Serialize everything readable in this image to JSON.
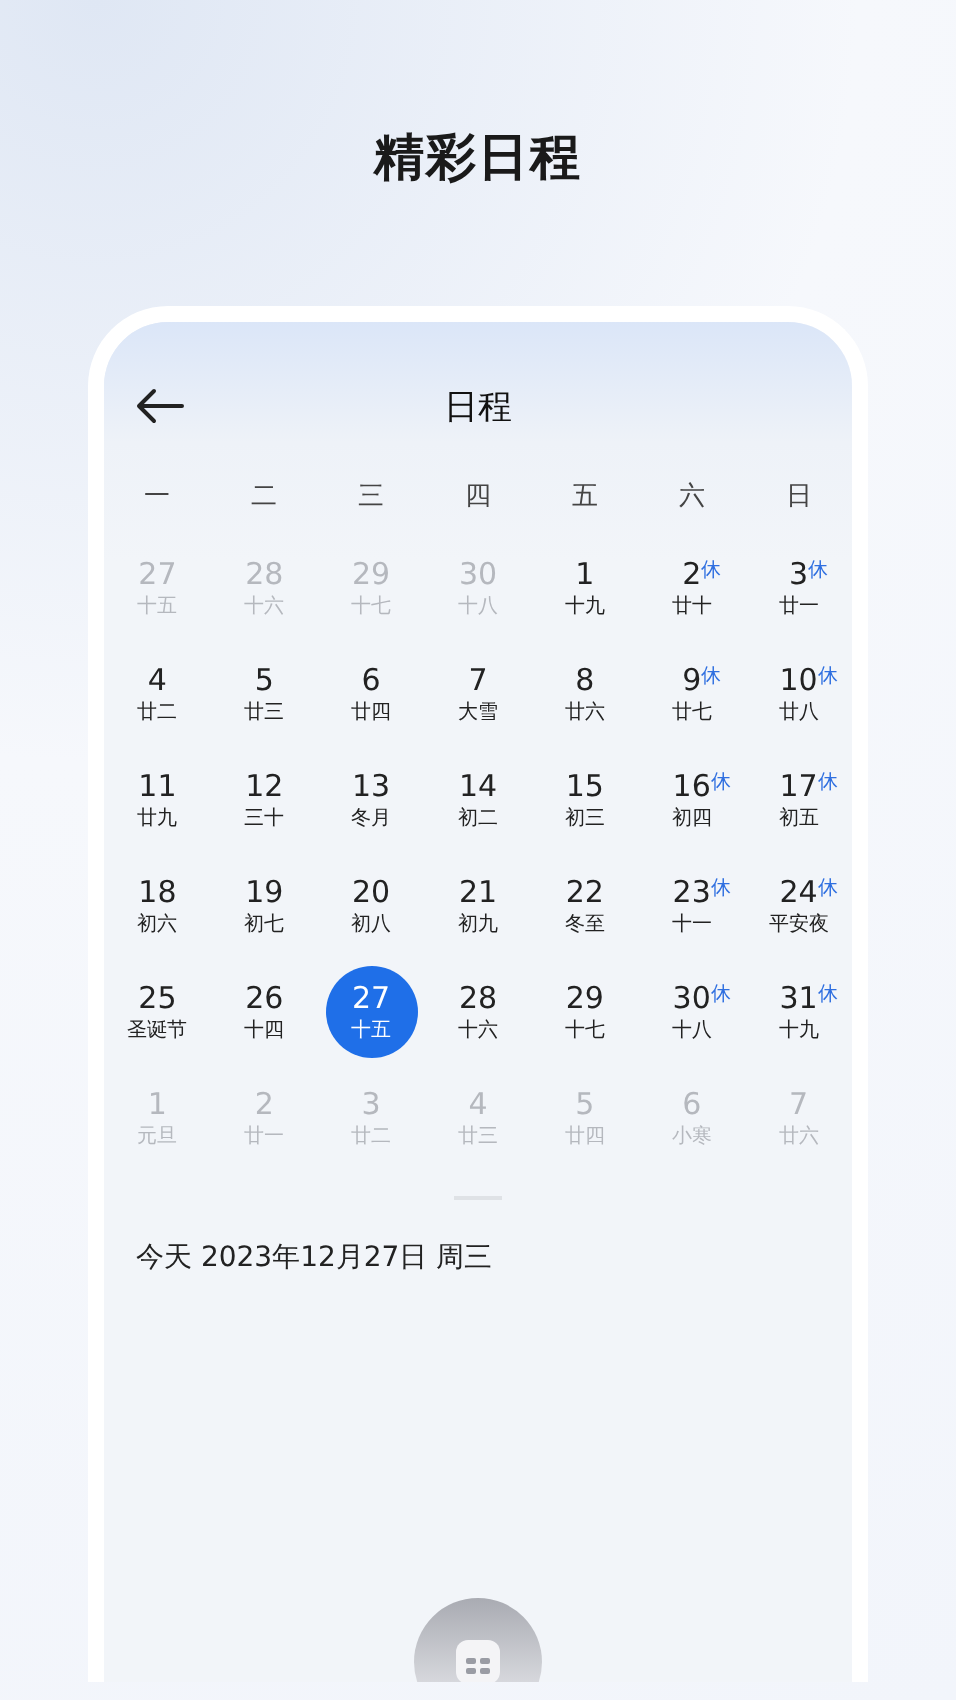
{
  "page_title": "精彩日程",
  "screen": {
    "title": "日程",
    "weekdays": [
      "一",
      "二",
      "三",
      "四",
      "五",
      "六",
      "日"
    ],
    "days": [
      {
        "day": "27",
        "lunar": "十五",
        "muted": true,
        "selected": false
      },
      {
        "day": "28",
        "lunar": "十六",
        "muted": true,
        "selected": false
      },
      {
        "day": "29",
        "lunar": "十七",
        "muted": true,
        "selected": false
      },
      {
        "day": "30",
        "lunar": "十八",
        "muted": true,
        "selected": false
      },
      {
        "day": "1",
        "lunar": "十九",
        "muted": false,
        "selected": false
      },
      {
        "day": "2",
        "lunar": "廿十",
        "badge": "休",
        "muted": false,
        "selected": false
      },
      {
        "day": "3",
        "lunar": "廿一",
        "badge": "休",
        "muted": false,
        "selected": false
      },
      {
        "day": "4",
        "lunar": "廿二",
        "muted": false,
        "selected": false
      },
      {
        "day": "5",
        "lunar": "廿三",
        "muted": false,
        "selected": false
      },
      {
        "day": "6",
        "lunar": "廿四",
        "muted": false,
        "selected": false
      },
      {
        "day": "7",
        "lunar": "大雪",
        "muted": false,
        "selected": false
      },
      {
        "day": "8",
        "lunar": "廿六",
        "muted": false,
        "selected": false
      },
      {
        "day": "9",
        "lunar": "廿七",
        "badge": "休",
        "muted": false,
        "selected": false
      },
      {
        "day": "10",
        "lunar": "廿八",
        "badge": "休",
        "muted": false,
        "selected": false
      },
      {
        "day": "11",
        "lunar": "廿九",
        "muted": false,
        "selected": false
      },
      {
        "day": "12",
        "lunar": "三十",
        "muted": false,
        "selected": false
      },
      {
        "day": "13",
        "lunar": "冬月",
        "muted": false,
        "selected": false
      },
      {
        "day": "14",
        "lunar": "初二",
        "muted": false,
        "selected": false
      },
      {
        "day": "15",
        "lunar": "初三",
        "muted": false,
        "selected": false
      },
      {
        "day": "16",
        "lunar": "初四",
        "badge": "休",
        "muted": false,
        "selected": false
      },
      {
        "day": "17",
        "lunar": "初五",
        "badge": "休",
        "muted": false,
        "selected": false
      },
      {
        "day": "18",
        "lunar": "初六",
        "muted": false,
        "selected": false
      },
      {
        "day": "19",
        "lunar": "初七",
        "muted": false,
        "selected": false
      },
      {
        "day": "20",
        "lunar": "初八",
        "muted": false,
        "selected": false
      },
      {
        "day": "21",
        "lunar": "初九",
        "muted": false,
        "selected": false
      },
      {
        "day": "22",
        "lunar": "冬至",
        "muted": false,
        "selected": false
      },
      {
        "day": "23",
        "lunar": "十一",
        "badge": "休",
        "muted": false,
        "selected": false
      },
      {
        "day": "24",
        "lunar": "平安夜",
        "badge": "休",
        "muted": false,
        "selected": false
      },
      {
        "day": "25",
        "lunar": "圣诞节",
        "muted": false,
        "selected": false
      },
      {
        "day": "26",
        "lunar": "十四",
        "muted": false,
        "selected": false
      },
      {
        "day": "27",
        "lunar": "十五",
        "muted": false,
        "selected": true
      },
      {
        "day": "28",
        "lunar": "十六",
        "muted": false,
        "selected": false
      },
      {
        "day": "29",
        "lunar": "十七",
        "muted": false,
        "selected": false
      },
      {
        "day": "30",
        "lunar": "十八",
        "badge": "休",
        "muted": false,
        "selected": false
      },
      {
        "day": "31",
        "lunar": "十九",
        "badge": "休",
        "muted": false,
        "selected": false
      },
      {
        "day": "1",
        "lunar": "元旦",
        "muted": true,
        "selected": false
      },
      {
        "day": "2",
        "lunar": "廿一",
        "muted": true,
        "selected": false
      },
      {
        "day": "3",
        "lunar": "廿二",
        "muted": true,
        "selected": false
      },
      {
        "day": "4",
        "lunar": "廿三",
        "muted": true,
        "selected": false
      },
      {
        "day": "5",
        "lunar": "廿四",
        "muted": true,
        "selected": false
      },
      {
        "day": "6",
        "lunar": "小寒",
        "muted": true,
        "selected": false
      },
      {
        "day": "7",
        "lunar": "廿六",
        "muted": true,
        "selected": false
      }
    ],
    "today": "今天 2023年12月27日 周三"
  }
}
